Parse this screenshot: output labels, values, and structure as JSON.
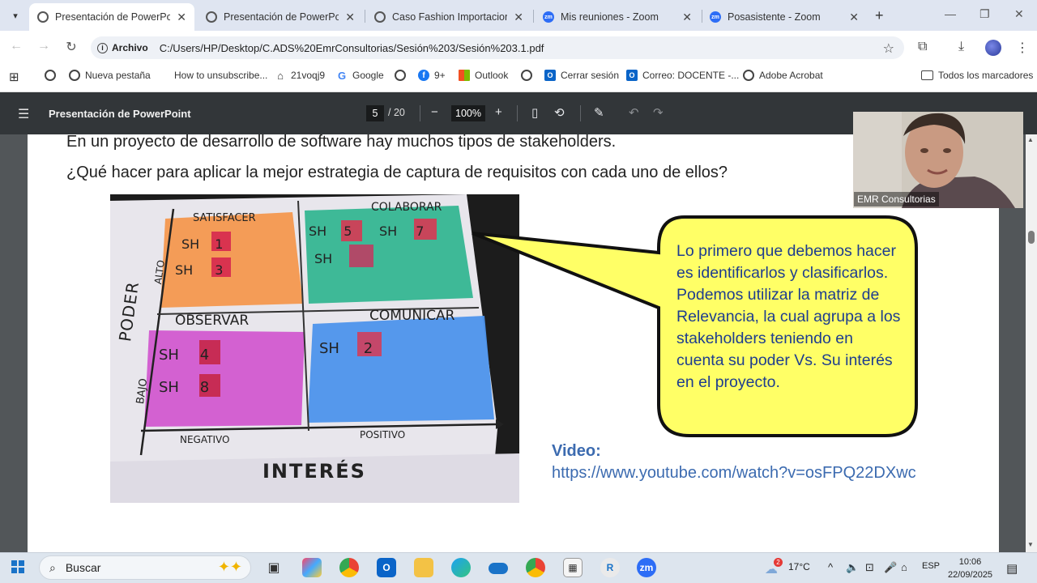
{
  "browser": {
    "tabs": [
      {
        "label": "Presentación de PowerPoint",
        "icon": "globe-icon",
        "active": true
      },
      {
        "label": "Presentación de PowerPoint",
        "icon": "globe-icon",
        "active": false
      },
      {
        "label": "Caso Fashion Importaciones",
        "icon": "globe-icon",
        "active": false
      },
      {
        "label": "Mis reuniones - Zoom",
        "icon": "zoom-icon",
        "active": false
      },
      {
        "label": "Posasistente - Zoom",
        "icon": "zoom-icon",
        "active": false
      }
    ],
    "zoom_badge": "zm",
    "omnibox": {
      "chip": "Archivo",
      "url": "C:/Users/HP/Desktop/C.ADS%20EmrConsultorias/Sesión%203/Sesión%203.1.pdf"
    },
    "bookmarks": [
      {
        "label": "Nueva pestaña",
        "icon": "globe-icon"
      },
      {
        "label": "How to unsubscribe...",
        "icon": "blank-icon"
      },
      {
        "label": "21voqj9",
        "icon": "house-icon"
      },
      {
        "label": "Google",
        "icon": "google-icon"
      },
      {
        "label": "",
        "icon": "globe-icon"
      },
      {
        "label": "9+",
        "icon": "facebook-icon"
      },
      {
        "label": "Outlook",
        "icon": "microsoft-icon"
      },
      {
        "label": "",
        "icon": "globe-icon"
      },
      {
        "label": "Cerrar sesión",
        "icon": "outlook-icon"
      },
      {
        "label": "Correo: DOCENTE -...",
        "icon": "outlook-icon"
      },
      {
        "label": "Adobe Acrobat",
        "icon": "globe-icon"
      }
    ],
    "all_bookmarks": "Todos los marcadores"
  },
  "pdf": {
    "title": "Presentación de PowerPoint",
    "page": "5",
    "total": "/ 20",
    "zoom": "100%"
  },
  "slide": {
    "line1": "En un proyecto de desarrollo de software hay muchos tipos de stakeholders.",
    "line2": "¿Qué hacer para aplicar la mejor estrategia de captura de requisitos con cada uno de ellos?",
    "callout": "Lo primero que debemos hacer es identificarlos y clasificarlos. Podemos utilizar la matriz de Relevancia, la cual agrupa a los stakeholders teniendo en cuenta su poder Vs. Su interés en el proyecto.",
    "video_label": "Video:",
    "video_url": "https://www.youtube.com/watch?v=osFPQ22DXwc",
    "matrix": {
      "y_axis": "PODER",
      "y_high": "ALTO",
      "y_low": "BAJO",
      "x_axis": "INTERÉS",
      "x_low": "NEGATIVO",
      "x_high": "POSITIVO",
      "quadrants": [
        {
          "title": "SATISFACER",
          "color": "#f4964a",
          "stickers": [
            {
              "label": "SH",
              "num": "1"
            },
            {
              "label": "SH",
              "num": "3"
            }
          ]
        },
        {
          "title": "COLABORAR",
          "color": "#2fb58f",
          "stickers": [
            {
              "label": "SH",
              "num": "5"
            },
            {
              "label": "SH",
              "num": "7"
            },
            {
              "label": "SH",
              "num": ""
            }
          ]
        },
        {
          "title": "OBSERVAR",
          "color": "#d25ad0",
          "stickers": [
            {
              "label": "SH",
              "num": "4"
            },
            {
              "label": "SH",
              "num": "8"
            }
          ]
        },
        {
          "title": "COMUNICAR",
          "color": "#4d93ec",
          "stickers": [
            {
              "label": "SH",
              "num": "2"
            }
          ]
        }
      ]
    }
  },
  "webcam": {
    "name": "EMR Consultorias"
  },
  "taskbar": {
    "search_placeholder": "Buscar",
    "weather": "17°C",
    "lang": "ESP",
    "time": "10:06",
    "date": "22/09/2025",
    "weather_badge": "2"
  }
}
